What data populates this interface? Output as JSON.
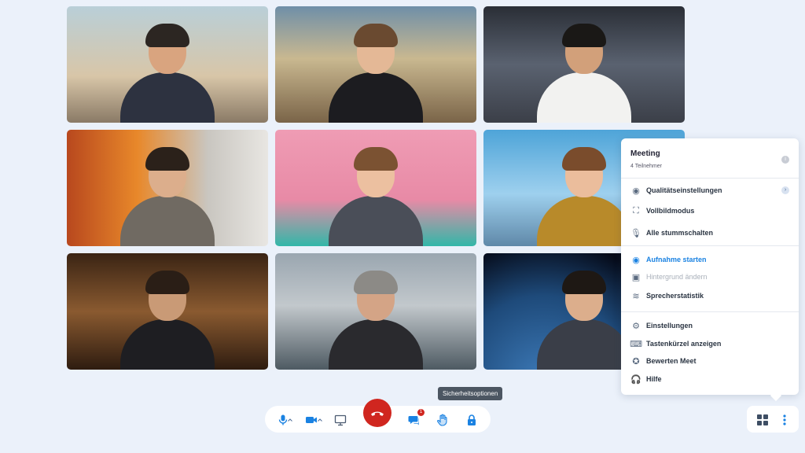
{
  "participants": [
    {
      "id": "t1",
      "skin": "#d9a47f",
      "hair": "#2c2622",
      "shirt": "#2d3240",
      "bg": "linear-gradient(180deg,#b9cfd8 0%,#d8c6a8 60%,#8a7a66 100%)"
    },
    {
      "id": "t2",
      "skin": "#e4b896",
      "hair": "#6a4a30",
      "shirt": "#1c1c20",
      "bg": "linear-gradient(180deg,#6f8fa8 0%,#c9b890 45%,#7a6448 100%)"
    },
    {
      "id": "t3",
      "skin": "#d2a07a",
      "hair": "#1a1816",
      "shirt": "#f2f2f0",
      "bg": "linear-gradient(180deg,#2a2e36 0%,#5a6270 50%,#3b3f48 100%)"
    },
    {
      "id": "t4",
      "skin": "#dcae8c",
      "hair": "#2b211a",
      "shirt": "#706a62",
      "bg": "linear-gradient(90deg,#b8481e 0%,#e8882a 35%,#c9c6c0 70%,#e8e6e2 100%)"
    },
    {
      "id": "t5",
      "skin": "#ecc0a0",
      "hair": "#7b5232",
      "shirt": "#4a4e58",
      "bg": "linear-gradient(180deg,#ef9cb4 0%,#e88aa6 60%,#32b7a8 100%)"
    },
    {
      "id": "t6",
      "skin": "#ebbd9c",
      "hair": "#7a4c2c",
      "shirt": "#b88a2a",
      "bg": "linear-gradient(180deg,#4ea4d8 0%,#9ed0ee 55%,#5f88a8 100%)"
    },
    {
      "id": "t7",
      "skin": "#c99a76",
      "hair": "#2a1e16",
      "shirt": "#1e1e22",
      "bg": "linear-gradient(180deg,#3a2414 0%,#8a5a30 50%,#2e1c10 100%)"
    },
    {
      "id": "t8",
      "skin": "#d4a486",
      "hair": "#8c8a86",
      "shirt": "#2a2a2e",
      "bg": "linear-gradient(180deg,#9aa6b0 0%,#c2c8cc 45%,#4e5a62 100%)"
    },
    {
      "id": "t9",
      "skin": "#dcae8c",
      "hair": "#1e1814",
      "shirt": "#3a3e48",
      "bg": "radial-gradient(circle at 30% 110%,#3d7ab8 0%,#1e4a7a 45%,#050a18 75%)"
    }
  ],
  "menu": {
    "title": "Meeting",
    "subtitle": "4 Teilnehmer",
    "info_icon": "info-icon",
    "items": [
      {
        "label": "Qualitätseinstellungen",
        "icon": "quality-icon",
        "glyph": "◉",
        "chevron": true
      },
      {
        "label": "Vollbildmodus",
        "icon": "fullscreen-icon",
        "glyph": "⛶"
      },
      {
        "label": "Alle stummschalten",
        "icon": "mute-all-icon",
        "glyph": "🎙"
      },
      {
        "label": "Aufnahme starten",
        "icon": "record-icon",
        "glyph": "◉",
        "active": true
      },
      {
        "label": "Hintergrund ändern",
        "icon": "background-icon",
        "glyph": "▣",
        "dim": true
      },
      {
        "label": "Sprecherstatistik",
        "icon": "speaker-stats-icon",
        "glyph": "≋"
      },
      {
        "label": "Einstellungen",
        "icon": "settings-icon",
        "glyph": "⚙"
      },
      {
        "label": "Tastenkürzel anzeigen",
        "icon": "keyboard-icon",
        "glyph": "⌨"
      },
      {
        "label": "Bewerten Meet",
        "icon": "rate-icon",
        "glyph": "✪"
      },
      {
        "label": "Hilfe",
        "icon": "help-icon",
        "glyph": "🎧"
      }
    ]
  },
  "toolbar": {
    "tooltip": "Sicherheitsoptionen",
    "chat_badge": "1",
    "accent": "#1a82e2",
    "hangup_color": "#d0261f"
  }
}
